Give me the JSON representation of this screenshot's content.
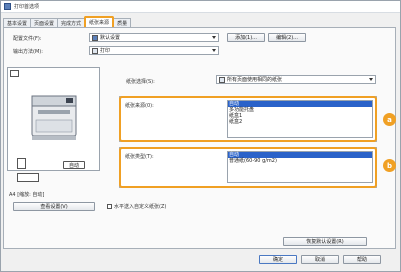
{
  "window": {
    "title": "打印首选项"
  },
  "tabs": [
    {
      "label": "基本设置"
    },
    {
      "label": "页面设置"
    },
    {
      "label": "完成方式"
    },
    {
      "label": "纸张来源"
    },
    {
      "label": "质量"
    }
  ],
  "profile": {
    "label": "配置文件(F):",
    "value": "默认设置",
    "add_label": "添加(1)...",
    "edit_label": "编辑(2)..."
  },
  "output": {
    "label": "输出方法(M):",
    "value": "打印"
  },
  "preview": {
    "auto_label": "自动",
    "caption": "A4 [缩放: 自动]",
    "view_settings_label": "查看设置(V)"
  },
  "paper_selection": {
    "label": "纸张选择(S):",
    "value": "所有页面使用相同的纸张"
  },
  "paper_source": {
    "label": "纸张来源(0):",
    "options": [
      "自动",
      "多功能托盘",
      "纸盒1",
      "纸盒2"
    ]
  },
  "paper_type": {
    "label": "纸张类型(T):",
    "options": [
      "自动",
      "普通纸(60-90 g/m2)"
    ]
  },
  "horizontal_paper": {
    "label": "水平送入自定义纸张(Z)"
  },
  "restore_defaults_label": "恢复默认设置(R)",
  "footer": {
    "ok": "确定",
    "cancel": "取消",
    "help": "帮助"
  },
  "callouts": {
    "a": "a",
    "b": "b"
  },
  "colors": {
    "accent": "#f0a024",
    "selection": "#2a62c9"
  }
}
